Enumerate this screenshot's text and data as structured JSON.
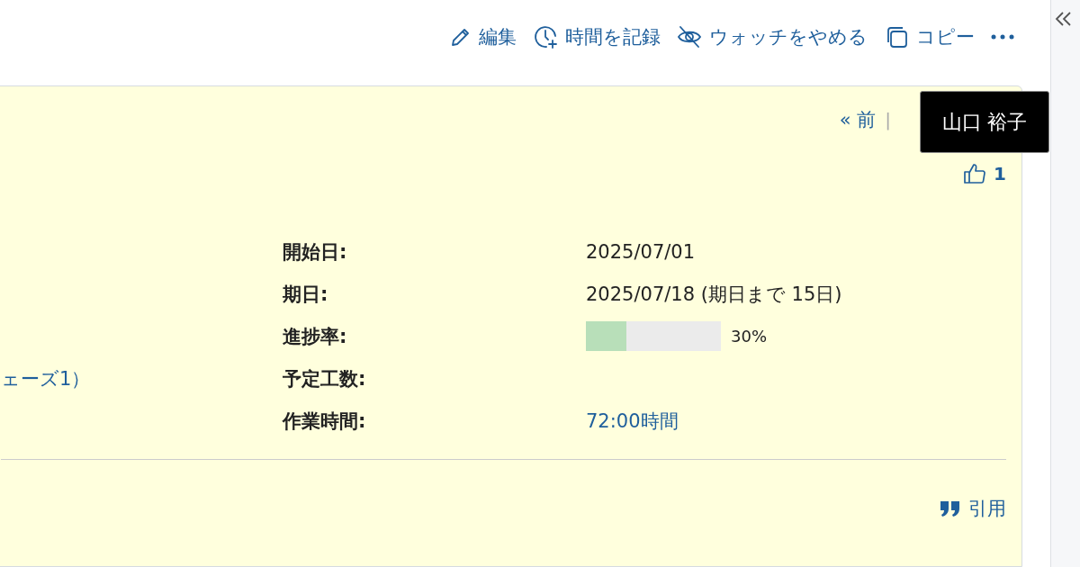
{
  "toolbar": {
    "actions": [
      {
        "kind": "edit",
        "label": "編集"
      },
      {
        "kind": "log-time",
        "label": "時間を記録"
      },
      {
        "kind": "unwatch",
        "label": "ウォッチをやめる"
      },
      {
        "kind": "copy",
        "label": "コピー"
      }
    ]
  },
  "issue": {
    "nav_prev": "« 前",
    "nav_separator": "|",
    "likes": "1",
    "tooltip": "山口 裕子",
    "attributes": [
      {
        "kind": "text",
        "label": "開始日:",
        "value": "2025/07/01"
      },
      {
        "kind": "text",
        "label": "期日:",
        "value": "2025/07/18 (期日まで 15日)"
      },
      {
        "kind": "progress",
        "label": "進捗率:",
        "level": 0.3,
        "value": "30%"
      },
      {
        "kind": "empty",
        "label": "予定工数:",
        "left_value": "ェーズ1）"
      },
      {
        "kind": "link",
        "label": "作業時間:",
        "value": "72:00時間"
      }
    ],
    "quote": "引用"
  }
}
